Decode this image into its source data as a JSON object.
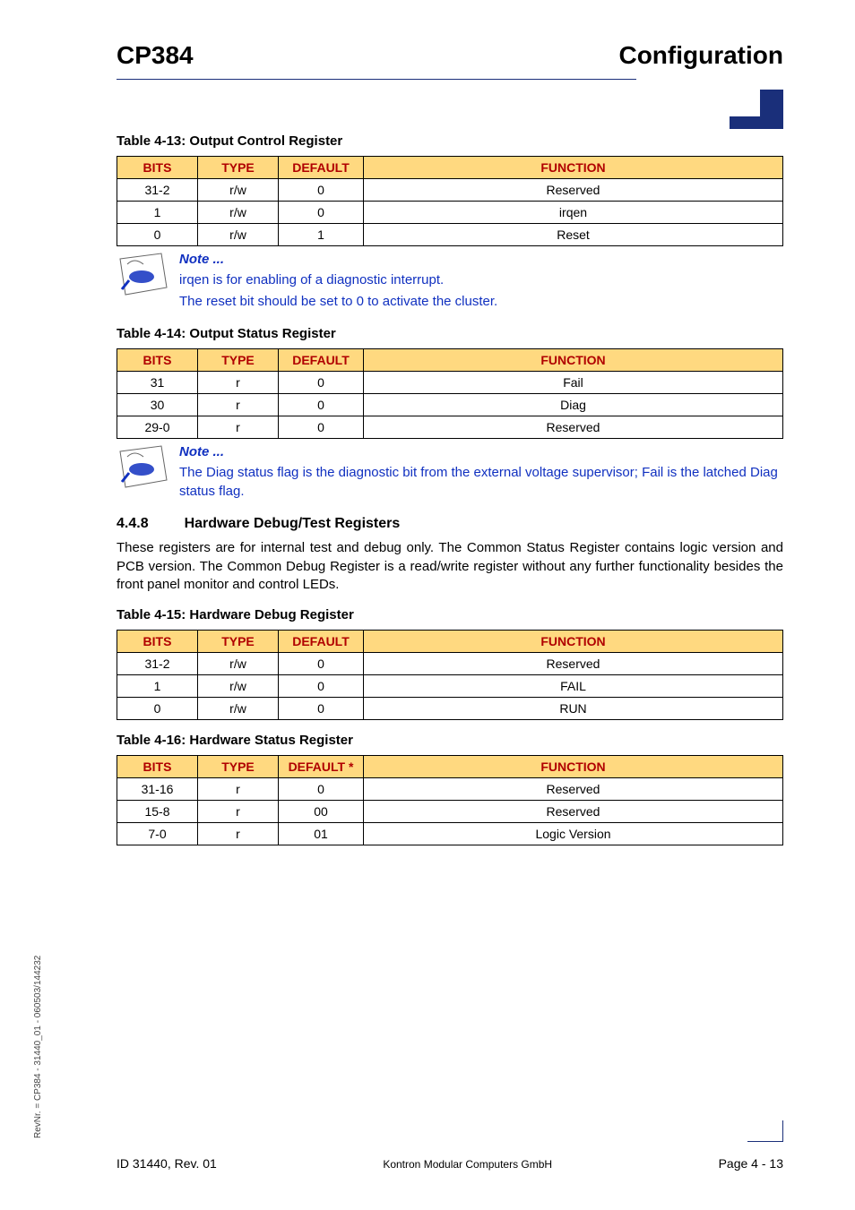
{
  "header": {
    "left": "CP384",
    "right": "Configuration"
  },
  "tables": {
    "t13": {
      "caption": "Table 4-13:  Output Control Register",
      "headers": [
        "BITS",
        "TYPE",
        "DEFAULT",
        "FUNCTION"
      ],
      "rows": [
        [
          "31-2",
          "r/w",
          "0",
          "Reserved"
        ],
        [
          "1",
          "r/w",
          "0",
          "irqen"
        ],
        [
          "0",
          "r/w",
          "1",
          "Reset"
        ]
      ]
    },
    "t14": {
      "caption": "Table 4-14:  Output Status Register",
      "headers": [
        "BITS",
        "TYPE",
        "DEFAULT",
        "FUNCTION"
      ],
      "rows": [
        [
          "31",
          "r",
          "0",
          "Fail"
        ],
        [
          "30",
          "r",
          "0",
          "Diag"
        ],
        [
          "29-0",
          "r",
          "0",
          "Reserved"
        ]
      ]
    },
    "t15": {
      "caption": "Table 4-15:  Hardware Debug Register",
      "headers": [
        "BITS",
        "TYPE",
        "DEFAULT",
        "FUNCTION"
      ],
      "rows": [
        [
          "31-2",
          "r/w",
          "0",
          "Reserved"
        ],
        [
          "1",
          "r/w",
          "0",
          "FAIL"
        ],
        [
          "0",
          "r/w",
          "0",
          "RUN"
        ]
      ]
    },
    "t16": {
      "caption": "Table 4-16:  Hardware Status Register",
      "headers": [
        "BITS",
        "TYPE",
        "DEFAULT *",
        "FUNCTION"
      ],
      "rows": [
        [
          "31-16",
          "r",
          "0",
          "Reserved"
        ],
        [
          "15-8",
          "r",
          "00",
          "Reserved"
        ],
        [
          "7-0",
          "r",
          "01",
          "Logic Version"
        ]
      ]
    }
  },
  "notes": {
    "n1": {
      "heading": "Note ...",
      "lines": [
        " irqen is for enabling of a diagnostic interrupt.",
        "The reset bit should be set to 0 to activate the cluster."
      ]
    },
    "n2": {
      "heading": "Note ...",
      "lines": [
        "The Diag status flag is the diagnostic bit from the external voltage supervisor; Fail is the latched Diag status flag."
      ]
    }
  },
  "section": {
    "num": "4.4.8",
    "title": "Hardware Debug/Test Registers",
    "para": "These registers are for internal test and debug only. The Common Status Register contains logic version and PCB version. The Common Debug Register is a read/write register without any further functionality besides the front panel monitor and control LEDs."
  },
  "sideRev": "RevNr. = CP384 - 31440_01 - 060503/144232",
  "footer": {
    "left": "ID 31440, Rev. 01",
    "center": "Kontron Modular Computers GmbH",
    "right": "Page 4 - 13"
  },
  "chart_data": [
    {
      "type": "table",
      "title": "Table 4-13: Output Control Register",
      "columns": [
        "BITS",
        "TYPE",
        "DEFAULT",
        "FUNCTION"
      ],
      "rows": [
        [
          "31-2",
          "r/w",
          "0",
          "Reserved"
        ],
        [
          "1",
          "r/w",
          "0",
          "irqen"
        ],
        [
          "0",
          "r/w",
          "1",
          "Reset"
        ]
      ]
    },
    {
      "type": "table",
      "title": "Table 4-14: Output Status Register",
      "columns": [
        "BITS",
        "TYPE",
        "DEFAULT",
        "FUNCTION"
      ],
      "rows": [
        [
          "31",
          "r",
          "0",
          "Fail"
        ],
        [
          "30",
          "r",
          "0",
          "Diag"
        ],
        [
          "29-0",
          "r",
          "0",
          "Reserved"
        ]
      ]
    },
    {
      "type": "table",
      "title": "Table 4-15: Hardware Debug Register",
      "columns": [
        "BITS",
        "TYPE",
        "DEFAULT",
        "FUNCTION"
      ],
      "rows": [
        [
          "31-2",
          "r/w",
          "0",
          "Reserved"
        ],
        [
          "1",
          "r/w",
          "0",
          "FAIL"
        ],
        [
          "0",
          "r/w",
          "0",
          "RUN"
        ]
      ]
    },
    {
      "type": "table",
      "title": "Table 4-16: Hardware Status Register",
      "columns": [
        "BITS",
        "TYPE",
        "DEFAULT *",
        "FUNCTION"
      ],
      "rows": [
        [
          "31-16",
          "r",
          "0",
          "Reserved"
        ],
        [
          "15-8",
          "r",
          "00",
          "Reserved"
        ],
        [
          "7-0",
          "r",
          "01",
          "Logic Version"
        ]
      ]
    }
  ]
}
